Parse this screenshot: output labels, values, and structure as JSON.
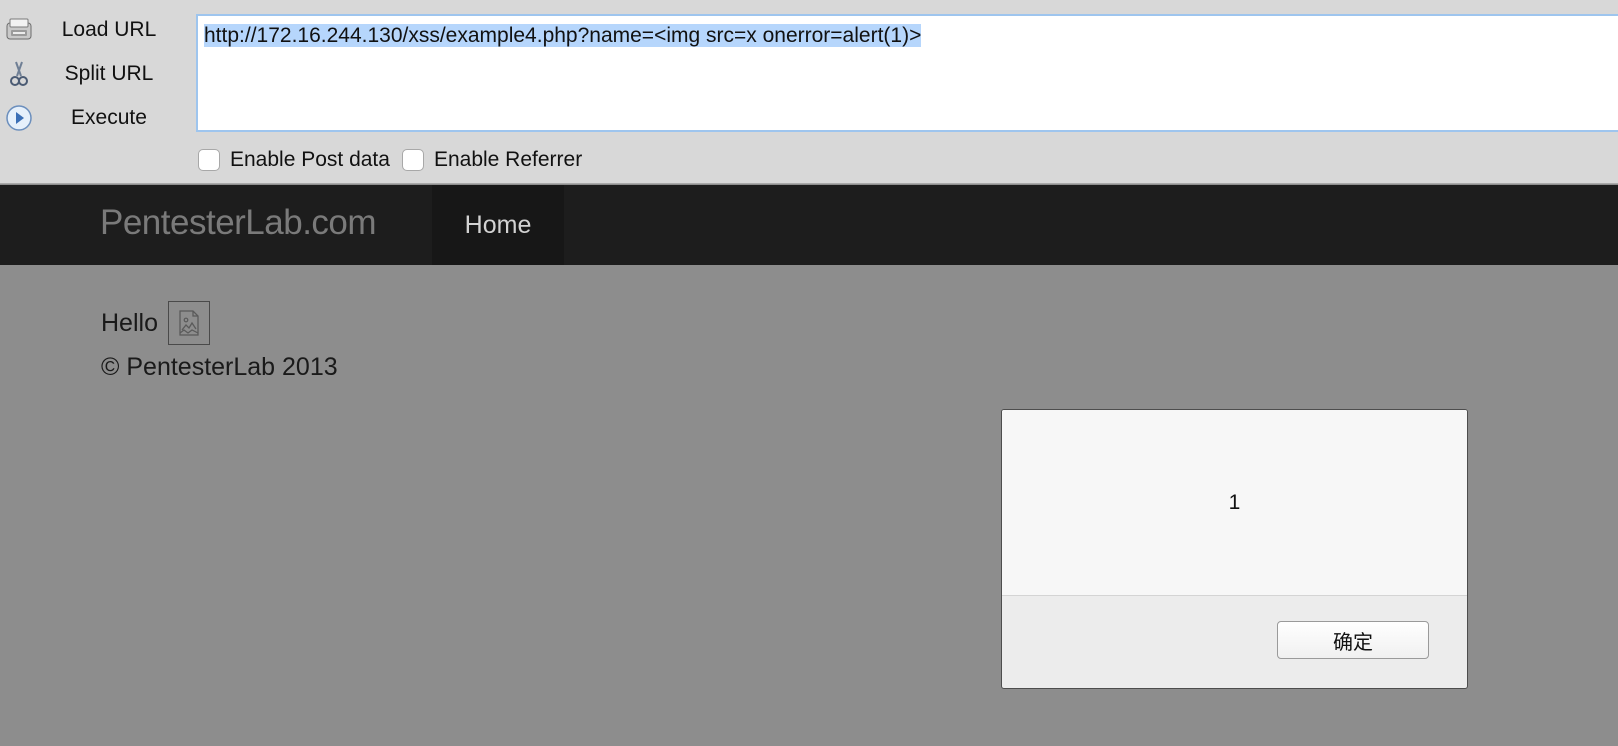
{
  "hackbar": {
    "buttons": [
      {
        "label": "Load URL",
        "icon": "load-url-icon"
      },
      {
        "label": "Split URL",
        "icon": "split-url-icon"
      },
      {
        "label": "Execute",
        "icon": "execute-icon"
      }
    ],
    "url_value": "http://172.16.244.130/xss/example4.php?name=<img src=x onerror=alert(1)>",
    "enable_post_label": "Enable Post data",
    "enable_referrer_label": "Enable Referrer",
    "enable_post_checked": false,
    "enable_referrer_checked": false
  },
  "navbar": {
    "brand": "PentesterLab.com",
    "home_label": "Home"
  },
  "page": {
    "hello_text": "Hello",
    "footer_text": "© PentesterLab 2013"
  },
  "dialog": {
    "message": "1",
    "ok_label": "确定"
  },
  "colors": {
    "page_background": "#8d8d8d",
    "navbar_background": "#1d1d1d",
    "url_selection": "#b6d6fc",
    "hackbar_background": "#d8d8d8"
  }
}
